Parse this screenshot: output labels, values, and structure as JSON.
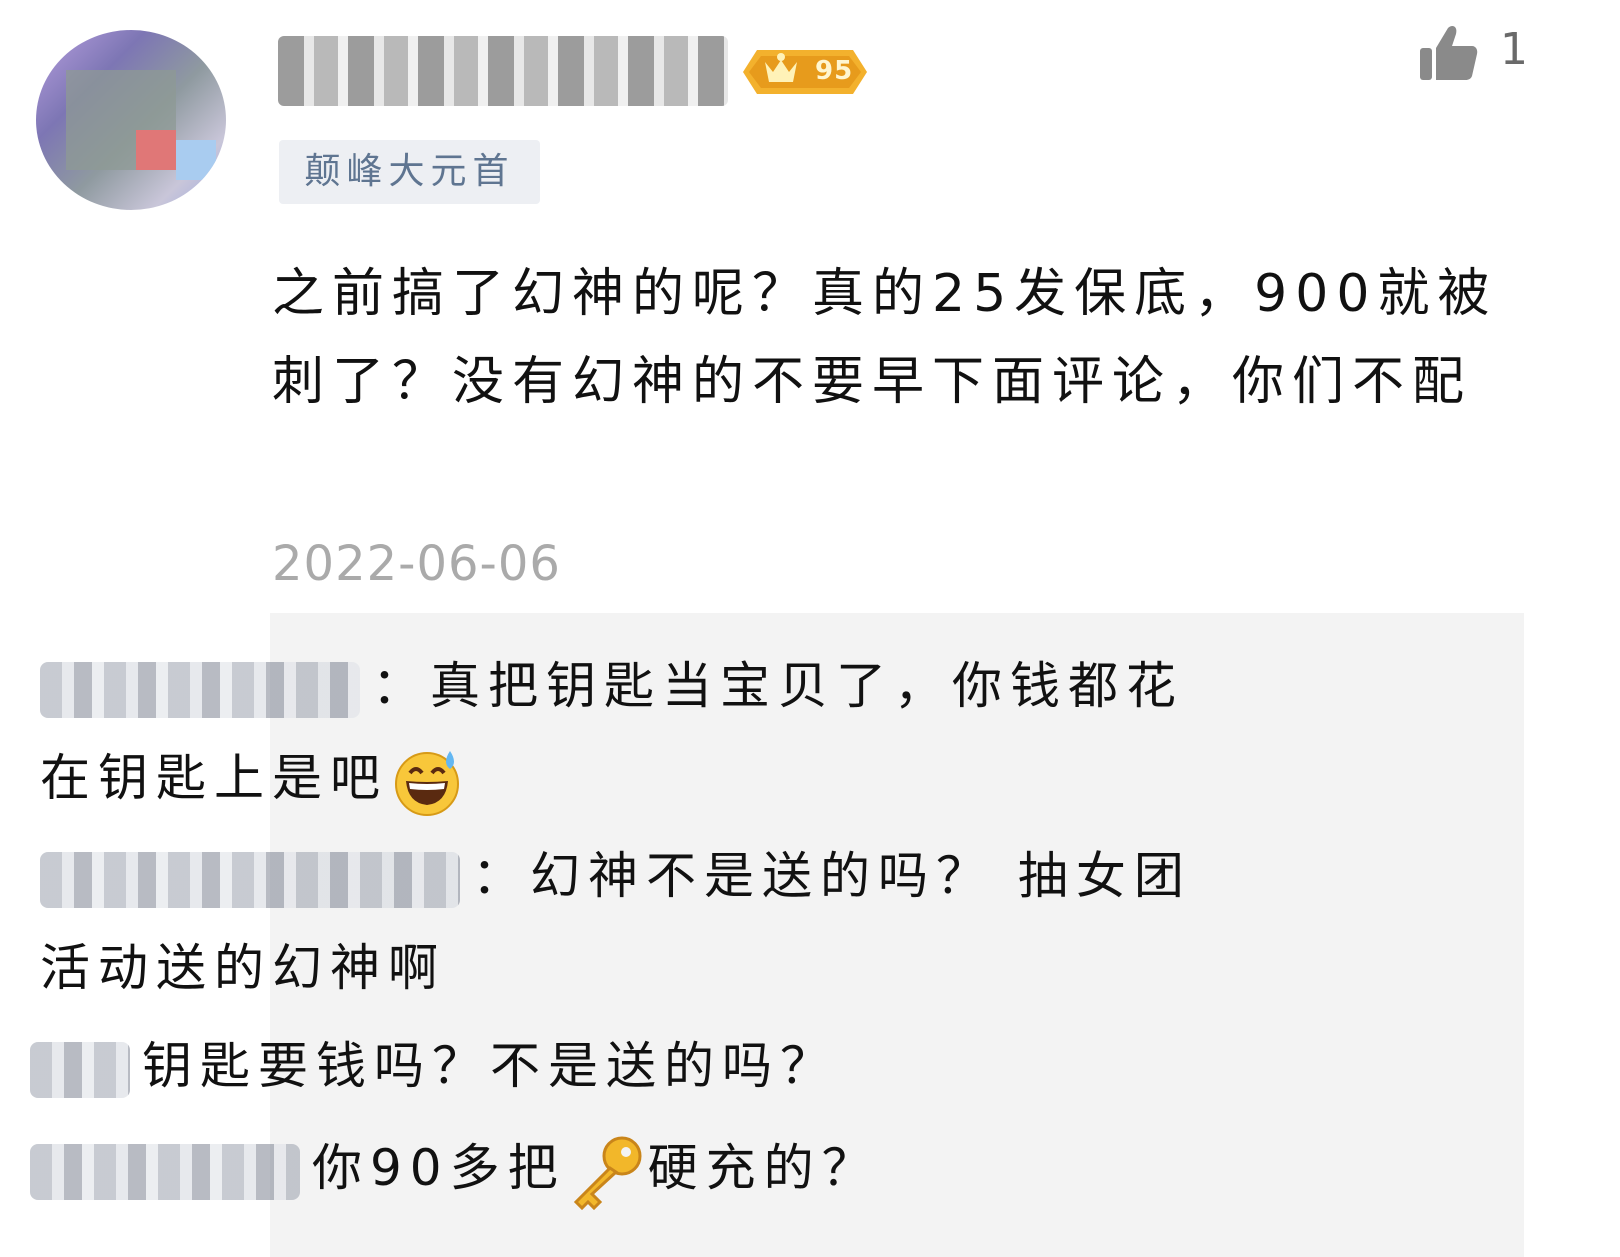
{
  "comment": {
    "username_visible": "",
    "level_badge": "95",
    "title_tag": "颠峰大元首",
    "likes": "1",
    "text": "之前搞了幻神的呢？真的25发保底，900就被刺了？没有幻神的不要早下面评论，你们不配",
    "date": "2022-06-06"
  },
  "replies": [
    {
      "text_before": "：真把钥匙当宝贝了，你钱都花在钥匙上是吧",
      "emoji": "grinning-sweat-emoji",
      "text_after": ""
    },
    {
      "text_before": "：幻神不是送的吗？ 抽女团活动送的幻神啊",
      "emoji": "",
      "text_after": ""
    },
    {
      "text_before": "钥匙要钱吗？不是送的吗？",
      "emoji": "",
      "text_after": ""
    },
    {
      "text_before": "你90多把",
      "emoji": "key-emoji",
      "text_after": "硬充的？"
    }
  ],
  "colors": {
    "badge_gold": "#f3b12d",
    "title_tag_bg": "#edeff3",
    "title_tag_text": "#5f7591",
    "date": "#aaaaaa",
    "reply_bg": "#f3f3f3"
  }
}
